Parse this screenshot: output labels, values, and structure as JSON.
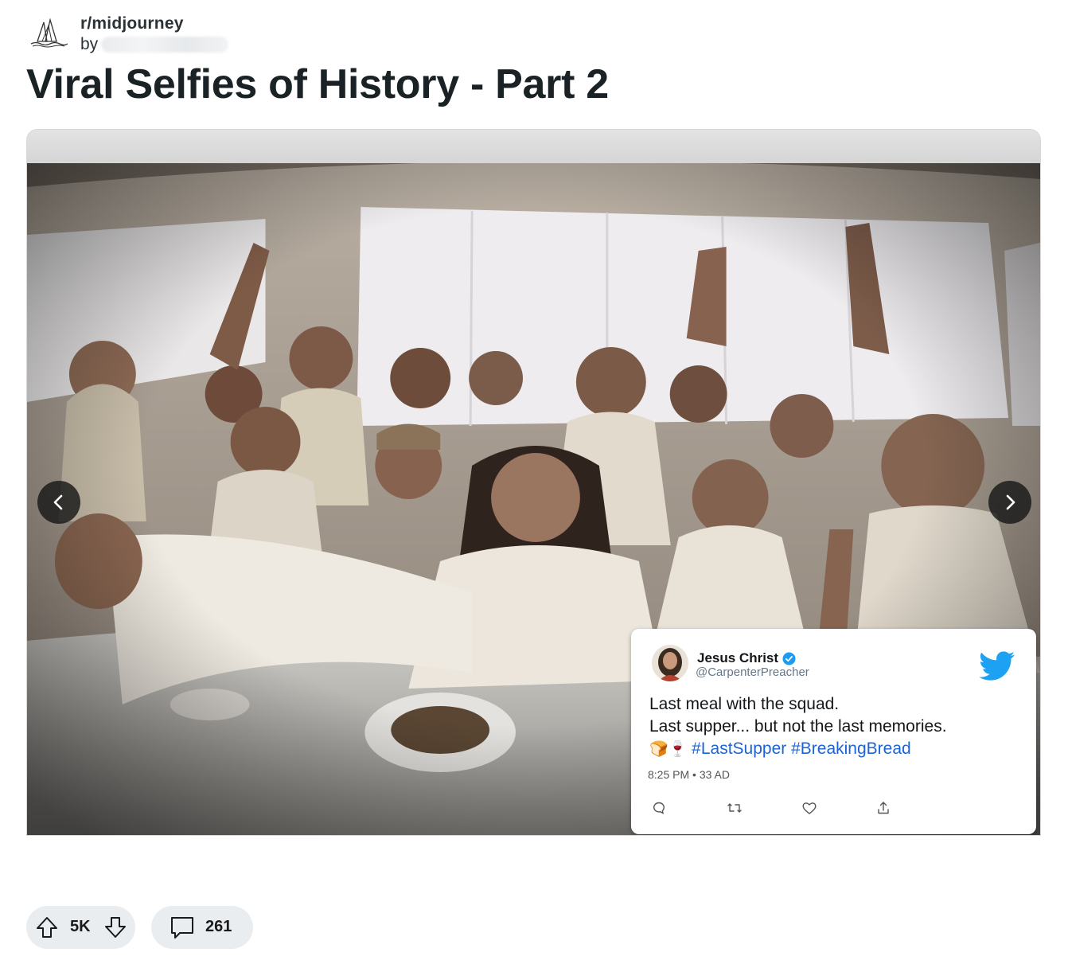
{
  "post": {
    "subreddit": "r/midjourney",
    "by_label": "by",
    "title": "Viral Selfies of History - Part 2"
  },
  "carousel": {
    "prev_icon": "chevron-left-icon",
    "next_icon": "chevron-right-icon"
  },
  "tweet": {
    "name": "Jesus Christ",
    "handle": "@CarpenterPreacher",
    "line1": "Last meal with the squad.",
    "line2": "Last supper... but not the last memories.",
    "emoji": "🍞🍷",
    "hashtags": "#LastSupper #BreakingBread",
    "time": "8:25 PM",
    "date": "33 AD",
    "accent_color": "#1da1f2",
    "hashtag_color": "#1b64d6"
  },
  "actions": {
    "upvote_icon": "arrow-up-icon",
    "score": "5K",
    "downvote_icon": "arrow-down-icon",
    "comment_icon": "comment-bubble-icon",
    "comment_count": "261"
  }
}
